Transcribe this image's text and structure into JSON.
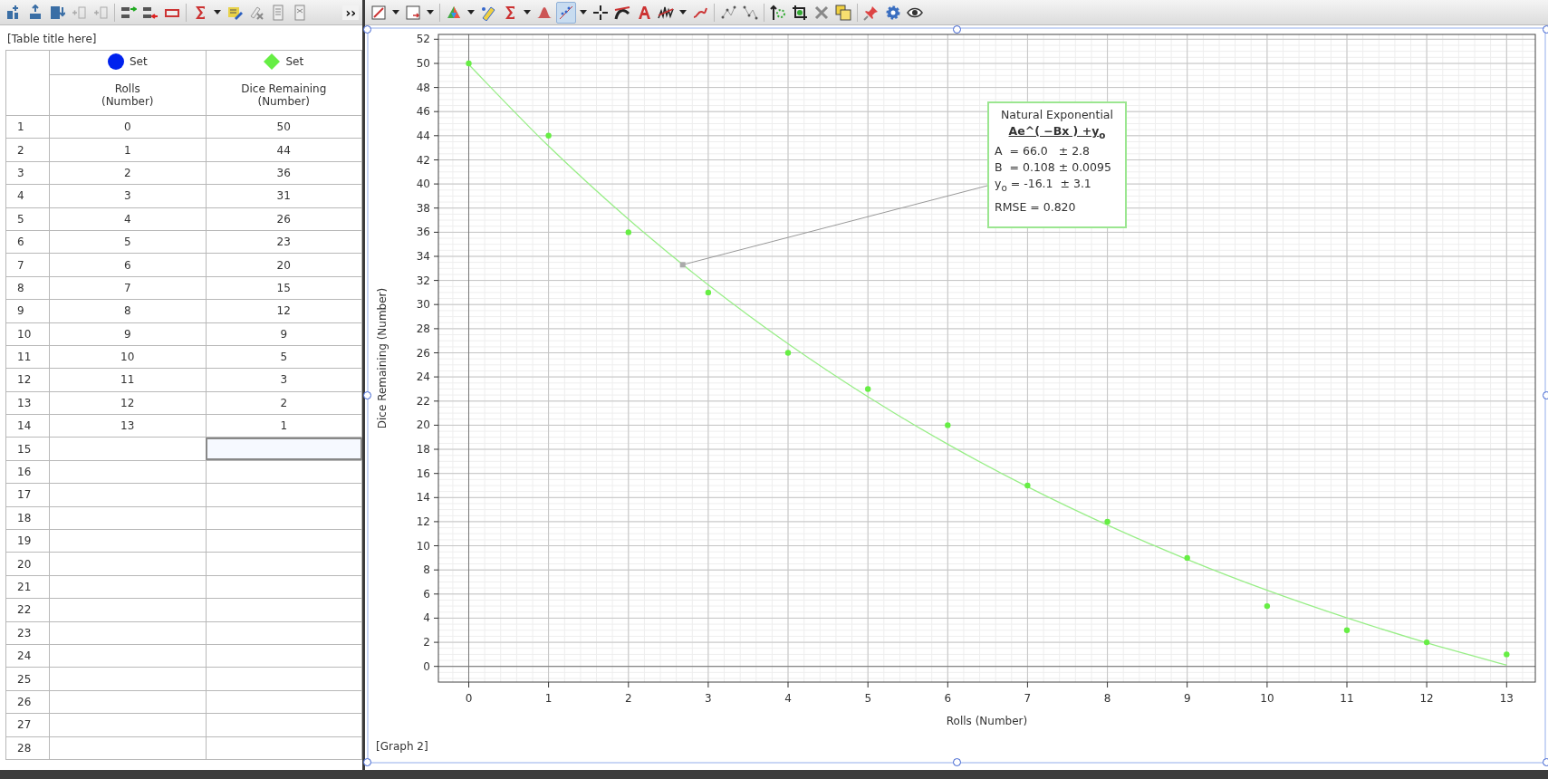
{
  "table_toolbar": {
    "overflow": "››"
  },
  "table": {
    "title": "[Table title here]",
    "columns": [
      {
        "set": "Set",
        "kind": "circle",
        "color": "#0022ee",
        "name": "Rolls",
        "unit": "(Number)"
      },
      {
        "set": "Set",
        "kind": "diamond",
        "color": "#66ee44",
        "name": "Dice Remaining",
        "unit": "(Number)"
      }
    ],
    "rows": [
      {
        "index": "1",
        "cells": [
          "0",
          "50"
        ],
        "selected": false
      },
      {
        "index": "2",
        "cells": [
          "1",
          "44"
        ],
        "selected": false
      },
      {
        "index": "3",
        "cells": [
          "2",
          "36"
        ],
        "selected": false
      },
      {
        "index": "4",
        "cells": [
          "3",
          "31"
        ],
        "selected": false
      },
      {
        "index": "5",
        "cells": [
          "4",
          "26"
        ],
        "selected": false
      },
      {
        "index": "6",
        "cells": [
          "5",
          "23"
        ],
        "selected": false
      },
      {
        "index": "7",
        "cells": [
          "6",
          "20"
        ],
        "selected": false
      },
      {
        "index": "8",
        "cells": [
          "7",
          "15"
        ],
        "selected": false
      },
      {
        "index": "9",
        "cells": [
          "8",
          "12"
        ],
        "selected": false
      },
      {
        "index": "10",
        "cells": [
          "9",
          "9"
        ],
        "selected": false
      },
      {
        "index": "11",
        "cells": [
          "10",
          "5"
        ],
        "selected": false
      },
      {
        "index": "12",
        "cells": [
          "11",
          "3"
        ],
        "selected": false
      },
      {
        "index": "13",
        "cells": [
          "12",
          "2"
        ],
        "selected": false
      },
      {
        "index": "14",
        "cells": [
          "13",
          "1"
        ],
        "selected": false
      },
      {
        "index": "15",
        "cells": [],
        "selected": true
      },
      {
        "index": "16",
        "cells": [],
        "selected": false
      },
      {
        "index": "17",
        "cells": [],
        "selected": false
      },
      {
        "index": "18",
        "cells": [],
        "selected": false
      },
      {
        "index": "19",
        "cells": [],
        "selected": false
      },
      {
        "index": "20",
        "cells": [],
        "selected": false
      },
      {
        "index": "21",
        "cells": [],
        "selected": false
      },
      {
        "index": "22",
        "cells": [],
        "selected": false
      },
      {
        "index": "23",
        "cells": [],
        "selected": false
      },
      {
        "index": "24",
        "cells": [],
        "selected": false
      },
      {
        "index": "25",
        "cells": [],
        "selected": false
      },
      {
        "index": "26",
        "cells": [],
        "selected": false
      },
      {
        "index": "27",
        "cells": [],
        "selected": false
      },
      {
        "index": "28",
        "cells": [],
        "selected": false
      }
    ]
  },
  "graph_toolbar": {
    "curve_fit_selected": true
  },
  "graph": {
    "title": "[Graph 2]",
    "selected": true,
    "chart_data": {
      "type": "scatter",
      "xlabel": "Rolls (Number)",
      "ylabel": "Dice Remaining (Number)",
      "x": [
        0,
        1,
        2,
        3,
        4,
        5,
        6,
        7,
        8,
        9,
        10,
        11,
        12,
        13
      ],
      "grid": true,
      "series": [
        {
          "color": "#66ee44",
          "values": [
            50,
            44,
            36,
            31,
            26,
            23,
            20,
            15,
            12,
            9,
            5,
            3,
            2,
            1
          ]
        },
        {
          "type": "line",
          "color": "#99ee88",
          "values": [
            49.9,
            43.14,
            37.08,
            31.64,
            26.75,
            22.36,
            18.42,
            14.89,
            11.72,
            8.87,
            6.31,
            4.02,
            1.96,
            0.11
          ]
        }
      ],
      "xlim": [
        -0.38,
        13.36
      ],
      "ylim": [
        -1.3,
        52.4
      ],
      "xticks": [
        0,
        1,
        2,
        3,
        4,
        5,
        6,
        7,
        8,
        9,
        10,
        11,
        12,
        13
      ],
      "yticks": [
        0,
        2,
        4,
        6,
        8,
        10,
        12,
        14,
        16,
        18,
        20,
        22,
        24,
        26,
        28,
        30,
        32,
        34,
        36,
        38,
        40,
        42,
        44,
        46,
        48,
        50,
        52
      ]
    },
    "fit_box": {
      "title": "Natural Exponential",
      "equation": "Ae^( −Bx ) +y$_{o}$",
      "lines": [
        "A  = 66.0   ± 2.8",
        "B  = 0.108 ± 0.0095",
        "y$_{o}$ = -16.1  ± 3.1"
      ],
      "rmse": "RMSE = 0.820"
    }
  }
}
